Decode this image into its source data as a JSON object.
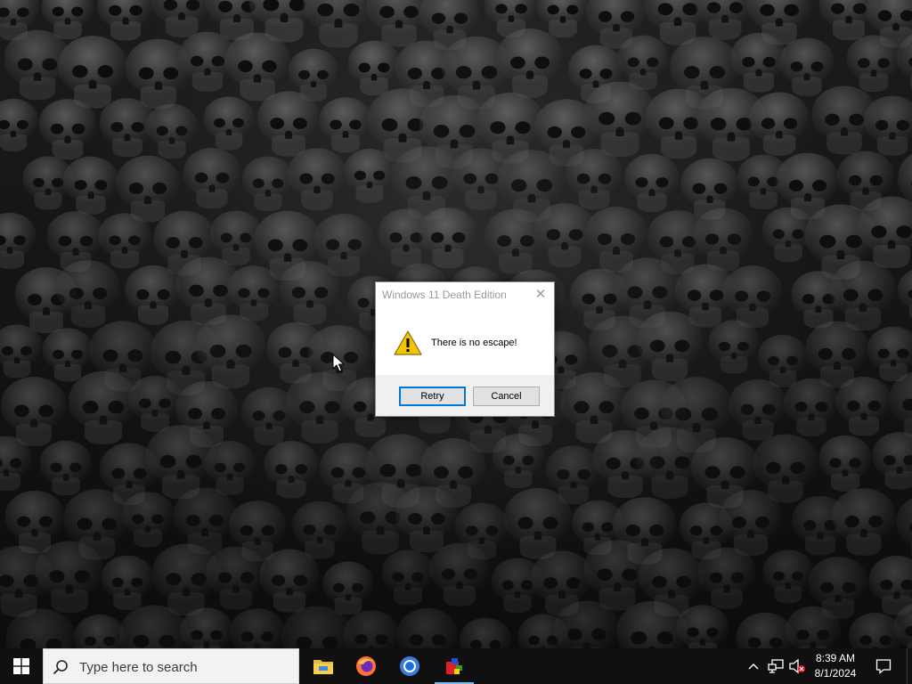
{
  "dialog": {
    "title": "Windows 11 Death Edition",
    "message": "There is no escape!",
    "retry_label": "Retry",
    "cancel_label": "Cancel",
    "close_symbol": "✕",
    "icon": "warning-icon"
  },
  "taskbar": {
    "search_placeholder": "Type here to search",
    "apps": [
      "file-explorer-icon",
      "firefox-icon",
      "chrome-icon",
      "paint-app-icon"
    ],
    "active_app": "paint-app-icon",
    "clock_time": "8:39 AM",
    "clock_date": "8/1/2024"
  },
  "wallpaper": {
    "theme": "skulls",
    "colors": {
      "dark": "#0c0c0c",
      "bone": "#8a8a8a"
    }
  },
  "colors": {
    "taskbar": "#101010",
    "accent": "#0078d7",
    "dialog_bg": "#f0f0f0",
    "warning": "#f5c400"
  }
}
